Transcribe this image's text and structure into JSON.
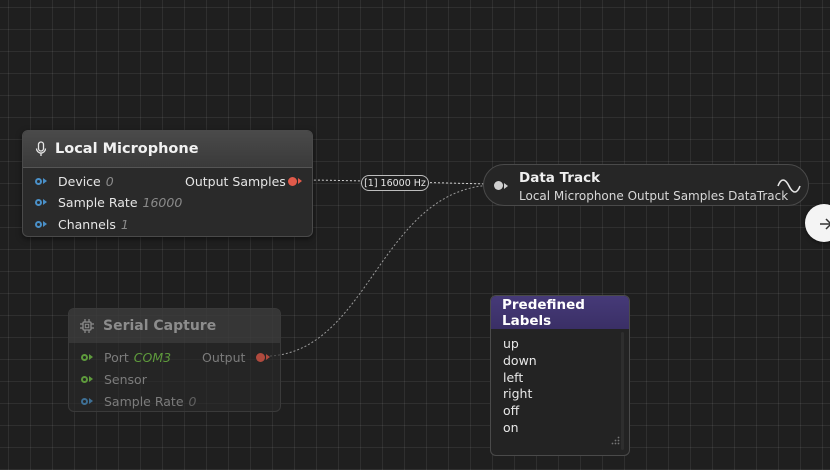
{
  "local_microphone": {
    "title": "Local Microphone",
    "icon": "microphone-icon",
    "inputs": [
      {
        "label": "Device",
        "value": "0"
      },
      {
        "label": "Sample Rate",
        "value": "16000"
      },
      {
        "label": "Channels",
        "value": "1"
      }
    ],
    "output_label": "Output Samples"
  },
  "connection_badge": "[1] 16000 Hz",
  "data_track": {
    "title": "Data Track",
    "subtitle": "Local Microphone Output Samples DataTrack",
    "icon": "waveform-icon"
  },
  "serial_capture": {
    "title": "Serial Capture",
    "icon": "chip-icon",
    "inputs": [
      {
        "label": "Port",
        "value": "COM3"
      },
      {
        "label": "Sensor",
        "value": ""
      },
      {
        "label": "Sample Rate",
        "value": "0"
      }
    ],
    "output_label": "Output"
  },
  "predefined_labels": {
    "title": "Predefined Labels",
    "items": [
      "up",
      "down",
      "left",
      "right",
      "off",
      "on"
    ]
  },
  "colors": {
    "background": "#1f1f1f",
    "input_port": "#4a90c8",
    "output_port": "#e05a4a",
    "labels_header": "#3f3370",
    "com_green": "#5e9a3c"
  }
}
